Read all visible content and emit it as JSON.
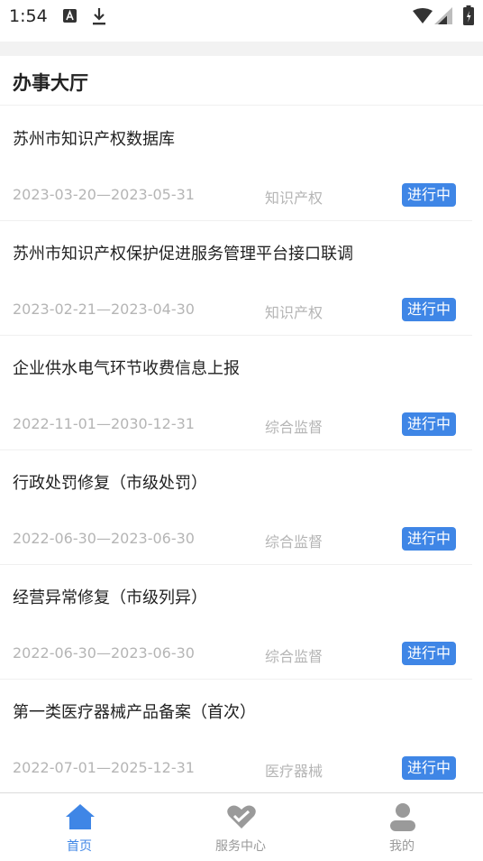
{
  "status_bar": {
    "time": "1:54",
    "icons": [
      "a-notification-icon",
      "download-icon",
      "wifi-icon",
      "signal-icon",
      "battery-icon"
    ]
  },
  "header": {
    "title": "办事大厅"
  },
  "list": {
    "items": [
      {
        "title": "苏州市知识产权数据库",
        "dates": "2023-03-20—2023-05-31",
        "category": "知识产权",
        "status": "进行中"
      },
      {
        "title": "苏州市知识产权保护促进服务管理平台接口联调",
        "dates": "2023-02-21—2023-04-30",
        "category": "知识产权",
        "status": "进行中"
      },
      {
        "title": "企业供水电气环节收费信息上报",
        "dates": "2022-11-01—2030-12-31",
        "category": "综合监督",
        "status": "进行中"
      },
      {
        "title": "行政处罚修复（市级处罚）",
        "dates": "2022-06-30—2023-06-30",
        "category": "综合监督",
        "status": "进行中"
      },
      {
        "title": "经营异常修复（市级列异）",
        "dates": "2022-06-30—2023-06-30",
        "category": "综合监督",
        "status": "进行中"
      },
      {
        "title": "第一类医疗器械产品备案（首次）",
        "dates": "2022-07-01—2025-12-31",
        "category": "医疗器械",
        "status": "进行中"
      }
    ]
  },
  "bottom_nav": {
    "home": "首页",
    "service": "服务中心",
    "mine": "我的",
    "active": "home"
  },
  "colors": {
    "accent": "#3f86e6",
    "muted_text": "#b5b5b5",
    "nav_inactive": "#9a9a9a",
    "divider": "#f0f0f0"
  }
}
